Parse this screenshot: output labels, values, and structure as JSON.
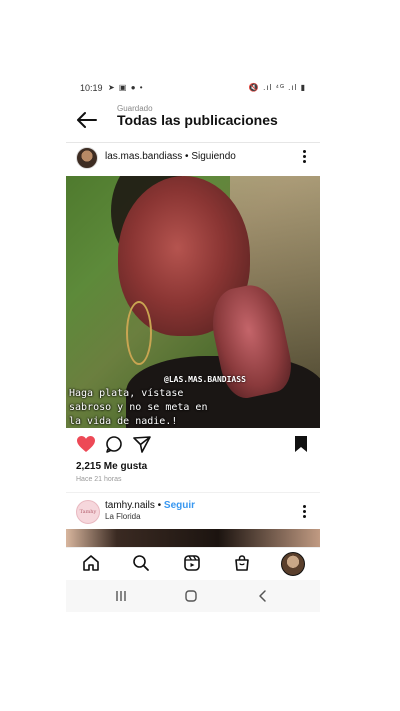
{
  "status_bar": {
    "time": "10:19",
    "left_icons": "➤ ▣ ● •",
    "right_icons": "🔇 .ıl ⁴ᴳ .ıl ▮"
  },
  "header": {
    "kicker": "Guardado",
    "title": "Todas las publicaciones"
  },
  "post": {
    "username": "las.mas.bandiass",
    "separator": " • ",
    "follow_state": "Siguiendo",
    "image_handle": "@LAS.MAS.BANDIASS",
    "image_quote": "Haga plata, vístase\nsabroso y no se meta en\nla vida de nadie.!",
    "likes": "2,215 Me gusta",
    "time_ago": "Hace 21 horas",
    "liked": true,
    "saved": true,
    "like_color": "#ed4956"
  },
  "post2": {
    "username": "tamhy.nails",
    "separator": " • ",
    "follow_label": "Seguir",
    "location": "La Florida",
    "avatar_text": "Tamhy Nails",
    "follow_color": "#3897f0"
  }
}
